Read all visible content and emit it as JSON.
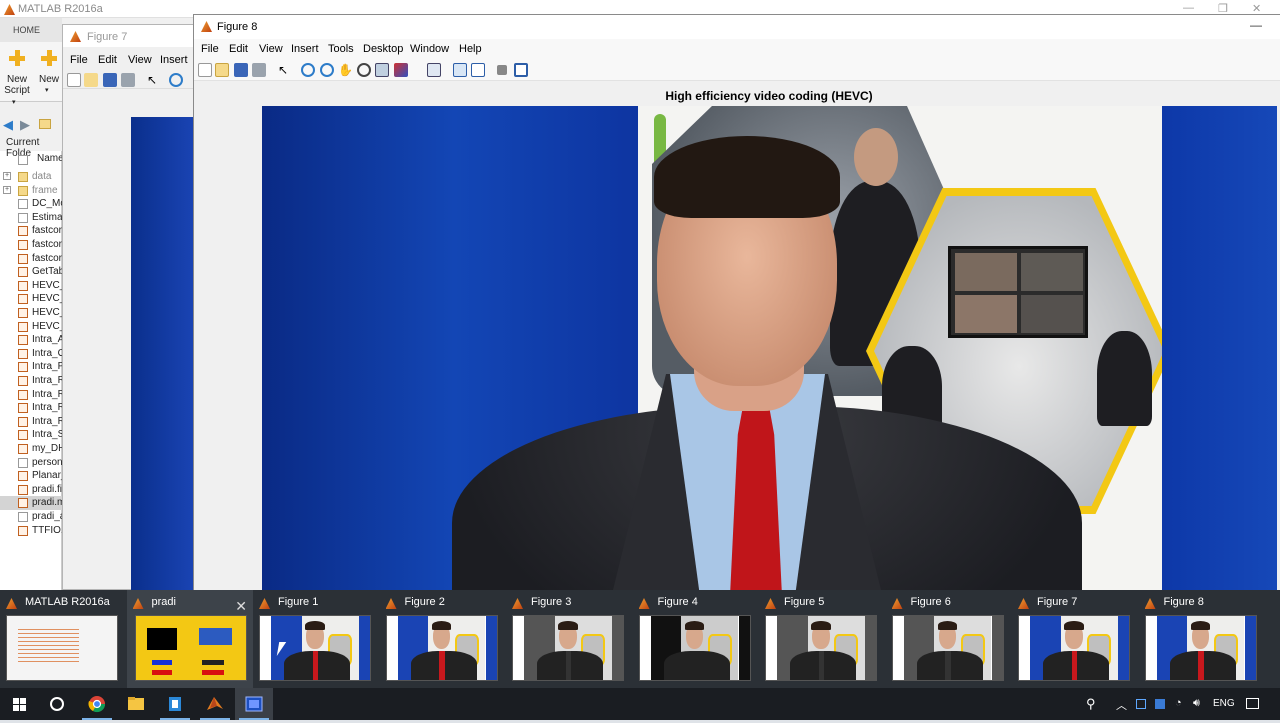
{
  "matlab": {
    "title": "MATLAB R2016a",
    "tab_home": "HOME",
    "new_script_label": "New\nScript",
    "new_label": "New",
    "current_folder_label": "Current Folde",
    "name_col": "Name",
    "files": [
      {
        "name": "data",
        "type": "folder"
      },
      {
        "name": "frame",
        "type": "folder"
      },
      {
        "name": "DC_Mo",
        "type": "file"
      },
      {
        "name": "Estimat",
        "type": "file"
      },
      {
        "name": "fastcor",
        "type": "m"
      },
      {
        "name": "fastcor",
        "type": "m"
      },
      {
        "name": "fastcor",
        "type": "m"
      },
      {
        "name": "GetTab",
        "type": "m"
      },
      {
        "name": "HEVC_",
        "type": "m"
      },
      {
        "name": "HEVC_",
        "type": "m"
      },
      {
        "name": "HEVC_",
        "type": "m"
      },
      {
        "name": "HEVC_",
        "type": "m"
      },
      {
        "name": "Intra_A",
        "type": "m"
      },
      {
        "name": "Intra_O",
        "type": "m"
      },
      {
        "name": "Intra_P",
        "type": "m"
      },
      {
        "name": "Intra_R",
        "type": "m"
      },
      {
        "name": "Intra_R",
        "type": "m"
      },
      {
        "name": "Intra_R",
        "type": "m"
      },
      {
        "name": "Intra_R",
        "type": "m"
      },
      {
        "name": "Intra_S",
        "type": "m"
      },
      {
        "name": "my_DH",
        "type": "m"
      },
      {
        "name": "person",
        "type": "file"
      },
      {
        "name": "Planar_",
        "type": "m"
      },
      {
        "name": "pradi.fi",
        "type": "m"
      },
      {
        "name": "pradi.m",
        "type": "m",
        "selected": true
      },
      {
        "name": "pradi_a",
        "type": "file"
      },
      {
        "name": "TTFIO.r",
        "type": "m"
      }
    ]
  },
  "figure7": {
    "title": "Figure 7",
    "menus": [
      "File",
      "Edit",
      "View",
      "Insert"
    ]
  },
  "figure8": {
    "title": "Figure 8",
    "menus": [
      "File",
      "Edit",
      "View",
      "Insert",
      "Tools",
      "Desktop",
      "Window",
      "Help"
    ],
    "plot_title": "High efficiency video coding (HEVC)",
    "toolbar_icons": [
      "new-figure-icon",
      "open-icon",
      "save-icon",
      "print-icon",
      "pointer-icon",
      "zoom-in-icon",
      "zoom-out-icon",
      "pan-icon",
      "rotate-icon",
      "data-cursor-icon",
      "brush-icon",
      "link-icon",
      "colorbar-icon",
      "legend-icon",
      "hide-tools-icon",
      "dock-icon"
    ]
  },
  "task_switcher": {
    "tiles": [
      {
        "label": "MATLAB R2016a",
        "kind": "matlab"
      },
      {
        "label": "pradi",
        "kind": "pradi",
        "active": true
      },
      {
        "label": "Figure 1",
        "kind": "color"
      },
      {
        "label": "Figure 2",
        "kind": "color"
      },
      {
        "label": "Figure 3",
        "kind": "gray"
      },
      {
        "label": "Figure 4",
        "kind": "gray-dark"
      },
      {
        "label": "Figure 5",
        "kind": "gray"
      },
      {
        "label": "Figure 6",
        "kind": "gray"
      },
      {
        "label": "Figure 7",
        "kind": "color"
      },
      {
        "label": "Figure 8",
        "kind": "color"
      }
    ]
  },
  "taskbar": {
    "language": "ENG",
    "apps": [
      "windows-start-icon",
      "cortana-icon",
      "chrome-icon",
      "file-explorer-icon",
      "generic-app-icon",
      "matlab-icon",
      "figure-window-icon"
    ]
  },
  "colors": {
    "video_blue": "#0f3fa8",
    "tie_red": "#c0151a",
    "hex_yellow": "#f3c814",
    "strip_bg": "#2b3036"
  }
}
